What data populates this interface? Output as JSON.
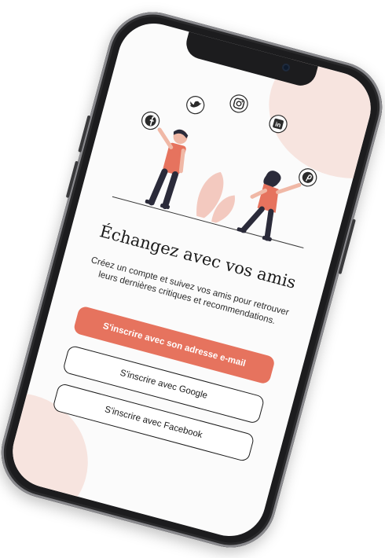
{
  "onboarding": {
    "title": "Échangez avec vos amis",
    "subtitle": "Créez un compte et suivez vos amis pour retrouver leurs dernières critiques et recommendations.",
    "email_button_label": "S'inscrire avec son adresse e-mail",
    "google_button_label": "S'inscrire avec Google",
    "facebook_button_label": "S'inscrire avec Facebook"
  },
  "illustration": {
    "icons": [
      "facebook-icon",
      "twitter-icon",
      "instagram-icon",
      "linkedin-icon",
      "pinterest-icon"
    ],
    "linkedin_glyph": "in",
    "facebook_glyph": "f"
  },
  "colors": {
    "accent": "#e6735e",
    "accent_soft": "#f7e4df",
    "text": "#1a1a1a",
    "phone_frame": "#1c1c1e"
  }
}
